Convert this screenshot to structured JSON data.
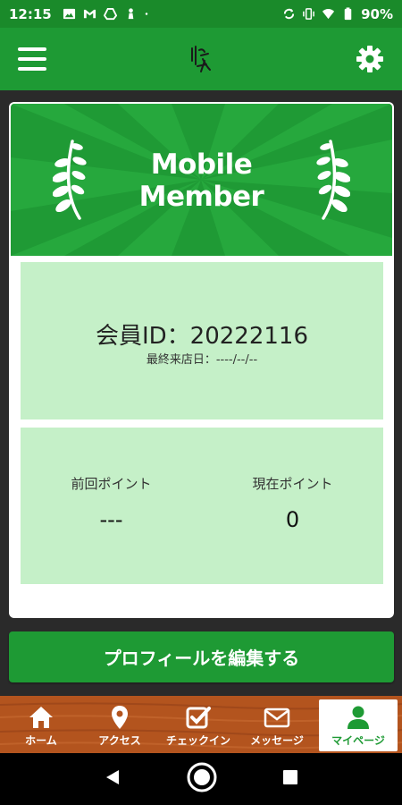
{
  "status_bar": {
    "time": "12:15",
    "battery_text": "90%",
    "left_icons": [
      "image-icon",
      "gmail-icon",
      "drive-icon",
      "chess-pawn-icon",
      "dot-icon"
    ],
    "right_icons": [
      "sync-icon",
      "vibrate-icon",
      "wifi-icon",
      "battery-icon"
    ]
  },
  "app_bar": {
    "menu_icon": "hamburger-menu-icon",
    "logo": "brand-logo",
    "settings_icon": "gear-icon"
  },
  "card": {
    "title_line1": "Mobile",
    "title_line2": "Member",
    "member_id_text": "会員ID：20222116",
    "last_visit_text": "最終来店日：----/--/--",
    "prev_points_label": "前回ポイント",
    "prev_points_value": "---",
    "curr_points_label": "現在ポイント",
    "curr_points_value": "0"
  },
  "edit_profile_label": "プロフィールを編集する",
  "bottom_nav": [
    {
      "label": "ホーム",
      "icon": "home-icon"
    },
    {
      "label": "アクセス",
      "icon": "map-pin-icon"
    },
    {
      "label": "チェックイン",
      "icon": "checkbox-icon"
    },
    {
      "label": "メッセージ",
      "icon": "envelope-icon"
    },
    {
      "label": "マイページ",
      "icon": "user-icon",
      "active": true
    }
  ],
  "colors": {
    "primary_green": "#1e9a34",
    "panel_green": "#c5f0c8",
    "nav_wood": "#b3541e"
  },
  "android_nav": [
    "back-icon",
    "home-circle-icon",
    "recents-icon"
  ]
}
